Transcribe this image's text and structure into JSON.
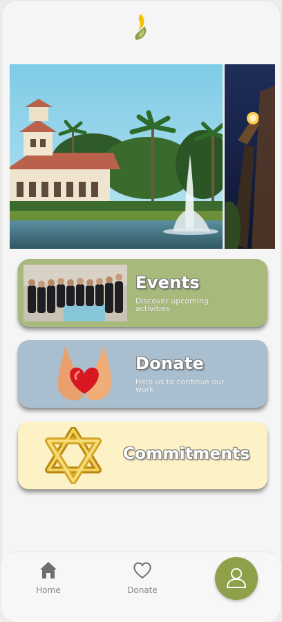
{
  "colors": {
    "accent": "#8ea04a",
    "events_card": "#a8b97c",
    "donate_card": "#a9bfcf",
    "commitments_card": "#fdf1c6",
    "tab_label": "#8a8a8a"
  },
  "header": {
    "logo_icon": "flame-logo-icon"
  },
  "hero": {
    "image": "building-with-fountain-and-torch-photo"
  },
  "cards": [
    {
      "title": "Events",
      "subtitle": "Discover upcoming activities",
      "image": "group-photo"
    },
    {
      "title": "Donate",
      "subtitle": "Help us to continue our work",
      "image": "hands-holding-heart"
    },
    {
      "title": "Commitments",
      "subtitle": "",
      "image": "star-of-david"
    }
  ],
  "tabbar": {
    "items": [
      {
        "label": "Home",
        "icon": "home-icon"
      },
      {
        "label": "Donate",
        "icon": "heart-icon"
      }
    ],
    "profile_icon": "user-icon"
  }
}
